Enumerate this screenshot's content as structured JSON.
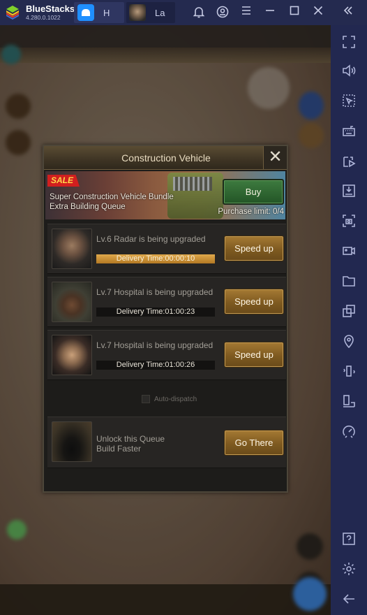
{
  "titlebar": {
    "brand": "BlueStacks",
    "version": "4.280.0.1022",
    "tabs": [
      {
        "label": "H",
        "icon": "home-icon"
      },
      {
        "label": "La",
        "icon": "game-avatar-icon"
      }
    ],
    "controls": [
      "bell-icon",
      "account-icon",
      "menu-icon",
      "minimize-icon",
      "maximize-icon",
      "close-icon",
      "collapse-sidebar-icon"
    ]
  },
  "sidebar": {
    "items": [
      "fullscreen-icon",
      "volume-icon",
      "select-pointer-icon",
      "keyboard-icon",
      "media-manager-icon",
      "install-apk-icon",
      "screenshot-icon",
      "record-video-icon",
      "folder-icon",
      "multi-instance-icon",
      "location-icon",
      "shake-icon",
      "rotate-icon",
      "performance-icon",
      "help-icon",
      "settings-icon",
      "back-icon"
    ]
  },
  "dialog": {
    "title": "Construction Vehicle",
    "close": "✕",
    "banner": {
      "badge": "SALE",
      "line1": "Super Construction Vehicle Bundle",
      "line2": "Extra Building Queue",
      "buy": "Buy",
      "purchase_limit": "Purchase limit: 0/4"
    },
    "queues": [
      {
        "title": "Lv.6 Radar is being upgraded",
        "timer": "Delivery Time:00:00:10",
        "button": "Speed up",
        "active": true
      },
      {
        "title": "Lv.7 Hospital is being upgraded",
        "timer": "Delivery Time:01:00:23",
        "button": "Speed up",
        "active": false
      },
      {
        "title": "Lv.7 Hospital is being upgraded",
        "timer": "Delivery Time:01:00:26",
        "button": "Speed up",
        "active": false
      }
    ],
    "auto_dispatch": "Auto-dispatch",
    "locked": {
      "line1": "Unlock this Queue",
      "line2": "Build Faster",
      "button": "Go There"
    }
  }
}
